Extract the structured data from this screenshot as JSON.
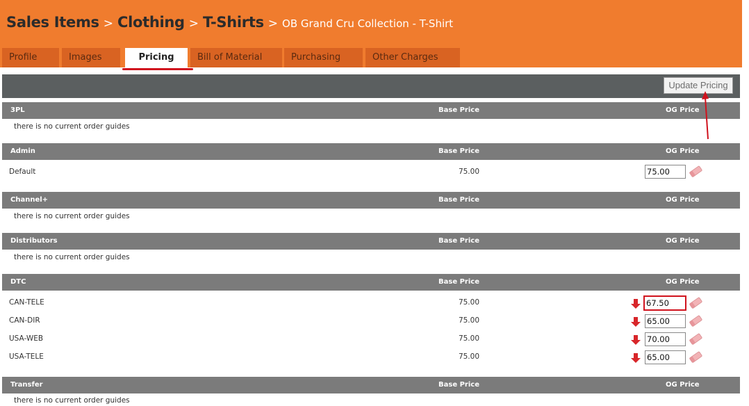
{
  "breadcrumb": {
    "level1": "Sales Items",
    "level2": "Clothing",
    "level3": "T-Shirts",
    "current": "OB Grand Cru Collection - T-Shirt",
    "separator": ">"
  },
  "tabs": [
    {
      "label": "Profile",
      "active": false
    },
    {
      "label": "Images",
      "active": false
    },
    {
      "label": "Pricing",
      "active": true
    },
    {
      "label": "Bill of Material",
      "active": false
    },
    {
      "label": "Purchasing",
      "active": false
    },
    {
      "label": "Other Charges",
      "active": false
    }
  ],
  "toolbar": {
    "update_label": "Update Pricing"
  },
  "columns": {
    "base_price": "Base Price",
    "og_price": "OG Price"
  },
  "empty_message": "there is no current order guides",
  "sections": [
    {
      "name": "3PL",
      "rows": []
    },
    {
      "name": "Admin",
      "rows": [
        {
          "label": "Default",
          "base": "75.00",
          "og": "75.00",
          "lower": false
        }
      ]
    },
    {
      "name": "Channel+",
      "rows": []
    },
    {
      "name": "Distributors",
      "rows": []
    },
    {
      "name": "DTC",
      "rows": [
        {
          "label": "CAN-TELE",
          "base": "75.00",
          "og": "67.50",
          "lower": true
        },
        {
          "label": "CAN-DIR",
          "base": "75.00",
          "og": "65.00",
          "lower": true
        },
        {
          "label": "USA-WEB",
          "base": "75.00",
          "og": "70.00",
          "lower": true
        },
        {
          "label": "USA-TELE",
          "base": "75.00",
          "og": "65.00",
          "lower": true
        }
      ]
    },
    {
      "name": "Transfer",
      "rows": []
    }
  ],
  "colors": {
    "header_orange": "#f07c2e",
    "tab_orange": "#d96322",
    "toolbar_gray": "#5b5f60",
    "section_gray": "#7b7b7b",
    "annotation_red": "#d0121d",
    "down_arrow_red": "#d8262a"
  },
  "icons": {
    "eraser": "eraser-icon",
    "down_arrow": "price-lower-arrow-icon"
  }
}
